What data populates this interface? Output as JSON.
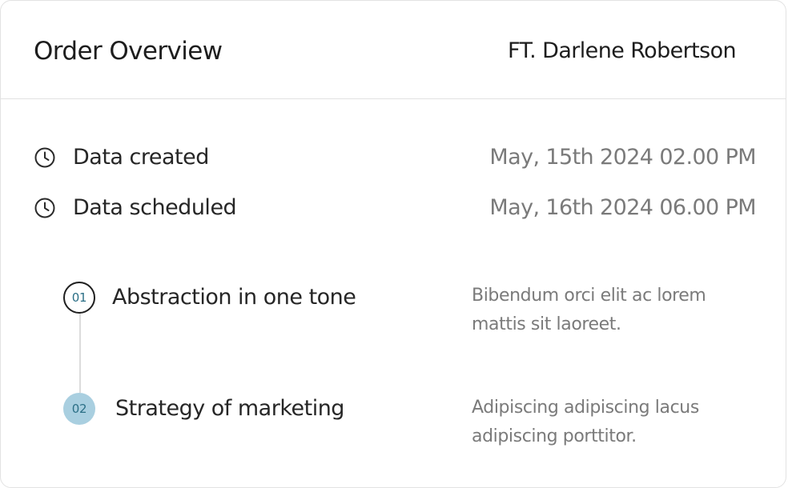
{
  "header": {
    "title": "Order Overview",
    "author": "FT. Darlene Robertson"
  },
  "meta": [
    {
      "icon": "clock-icon",
      "label": "Data created",
      "value": "May, 15th 2024 02.00 PM"
    },
    {
      "icon": "clock-icon",
      "label": "Data scheduled",
      "value": "May, 16th 2024 06.00 PM"
    }
  ],
  "steps": [
    {
      "number": "01",
      "title": "Abstraction in one tone",
      "description": "Bibendum orci elit ac lorem mattis sit laoreet.",
      "state": "outline"
    },
    {
      "number": "02",
      "title": "Strategy of marketing",
      "description": "Adipiscing adipiscing lacus adipiscing porttitor.",
      "state": "filled"
    }
  ],
  "colors": {
    "border": "#e2e2e2",
    "text_primary": "#1d1d1d",
    "text_secondary": "#7a7a7a",
    "badge_fill": "#a9cfe0",
    "badge_text": "#2b6f86"
  }
}
